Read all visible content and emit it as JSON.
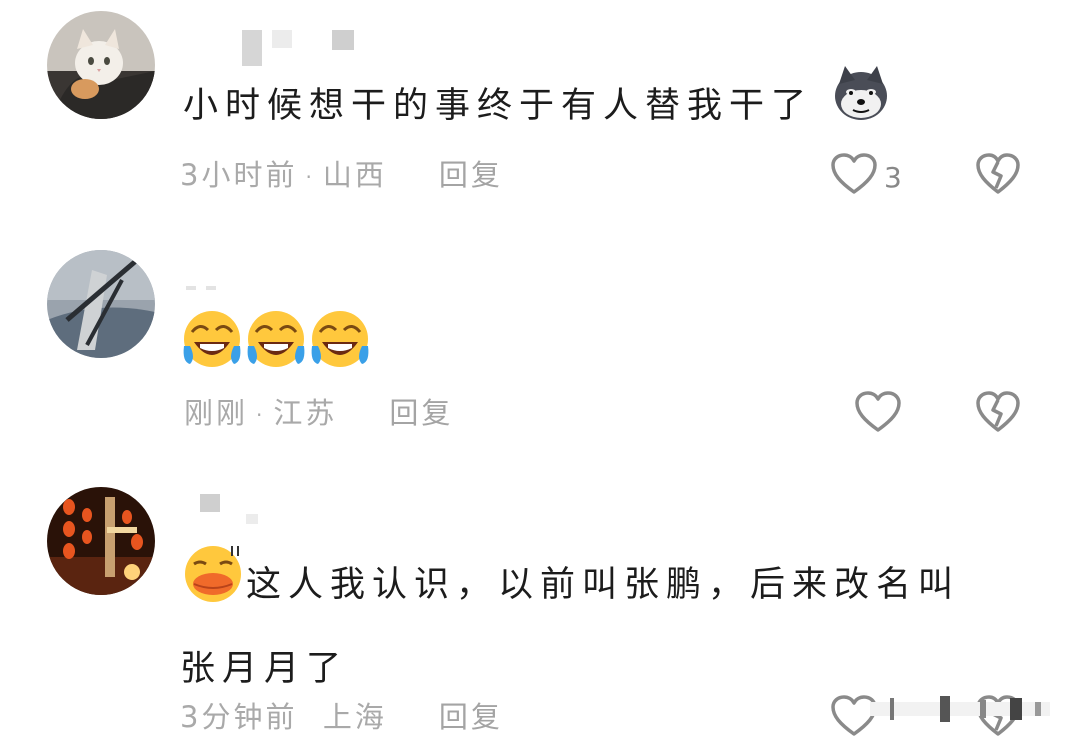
{
  "comments": [
    {
      "text": "小时候想干的事终于有人替我干了",
      "time": "3小时前",
      "location": "山西",
      "reply": "回复",
      "likes": "3",
      "emojis": [
        "doge-emoji"
      ]
    },
    {
      "text": "",
      "time": "刚刚",
      "location": "江苏",
      "reply": "回复",
      "likes": "",
      "emojis": [
        "laugh-cry-emoji",
        "laugh-cry-emoji",
        "laugh-cry-emoji"
      ]
    },
    {
      "text_line1": "这人我认识，以前叫张鹏，后来改名叫",
      "text_line2": "张月月了",
      "time": "3分钟前",
      "location": "上海",
      "reply": "回复",
      "likes": "",
      "emojis": [
        "duck-lips-emoji"
      ]
    }
  ],
  "icons": {
    "like": "heart-outline-icon",
    "dislike": "broken-heart-icon"
  },
  "colors": {
    "meta_text": "#a9a9a9",
    "icon_stroke": "#8a8a8a",
    "emoji_yellow": "#ffc83d"
  }
}
